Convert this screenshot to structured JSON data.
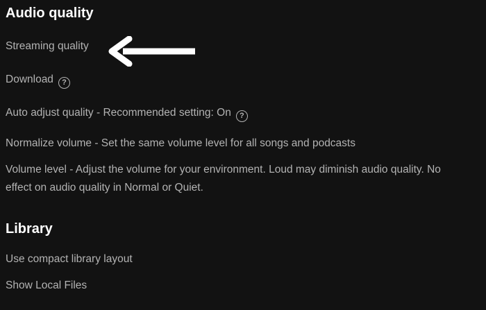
{
  "audio_quality": {
    "title": "Audio quality",
    "streaming_quality": "Streaming quality",
    "download": "Download",
    "auto_adjust": "Auto adjust quality - Recommended setting: On",
    "normalize": "Normalize volume - Set the same volume level for all songs and podcasts",
    "volume_level": "Volume level - Adjust the volume for your environment. Loud may diminish audio quality. No effect on audio quality in Normal or Quiet."
  },
  "library": {
    "title": "Library",
    "compact_layout": "Use compact library layout",
    "local_files": "Show Local Files"
  },
  "icons": {
    "help": "?"
  },
  "colors": {
    "background": "#121212",
    "heading": "#ffffff",
    "text": "#b3b3b3",
    "arrow": "#ffffff"
  }
}
